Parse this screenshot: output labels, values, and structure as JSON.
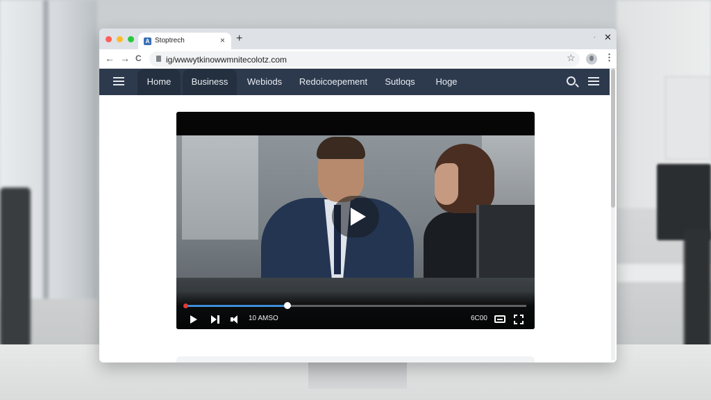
{
  "browser": {
    "tab_title": "Stoptrech",
    "favicon_letter": "A",
    "new_tab": "+",
    "tab_close": "×",
    "window_controls": "ᐧ",
    "window_close": "✕",
    "back": "←",
    "forward": "→",
    "reload": "C",
    "url": "ig/wwwytkinowwmnitecolotz.com",
    "bookmark": "☆",
    "menu": "⋮"
  },
  "sitenav": {
    "items": [
      {
        "label": "Home",
        "active": true
      },
      {
        "label": "Business",
        "active": true
      },
      {
        "label": "Webiods",
        "active": false
      },
      {
        "label": "Redoicoepement",
        "active": false
      },
      {
        "label": "Sutloqs",
        "active": false
      },
      {
        "label": "Hoge",
        "active": false
      }
    ]
  },
  "player": {
    "progress": 0.3,
    "time": "10 AMSO",
    "quality": "6C00"
  },
  "colors": {
    "nav_bg": "#2d3a4d",
    "progress": "#3e8fd8"
  }
}
